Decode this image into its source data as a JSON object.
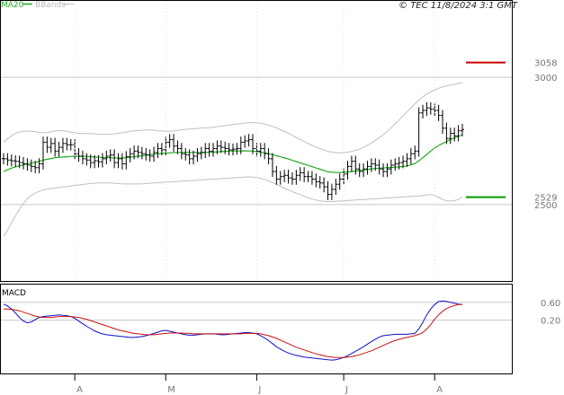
{
  "header": {
    "legend_ma": "MA20",
    "legend_bb": "BBands",
    "stamp": "© TEC 11/8/2024 3:1 GMT"
  },
  "colors": {
    "price": "#000000",
    "ma": "#22aa22",
    "bbands": "#c0c0c0",
    "resistance": "#cc0000",
    "support": "#009900",
    "macd_line": "#1010cc",
    "signal_line": "#cc1010",
    "grid": "#c8c8c8"
  },
  "chart_data": [
    {
      "type": "ohlc",
      "ylim": [
        2200,
        3300
      ],
      "yticks": [
        {
          "label": "3000",
          "value": 3000
        },
        {
          "label": "2500",
          "value": 2500
        }
      ],
      "xticks": [
        "A",
        "M",
        "J",
        "J",
        "A"
      ],
      "xtick_index": [
        18,
        41,
        64,
        86,
        109
      ],
      "levels": [
        {
          "label": "3058",
          "value": 3058,
          "kind": "resistance"
        },
        {
          "label": "2529",
          "value": 2529,
          "kind": "support"
        }
      ],
      "close": [
        2680,
        2675,
        2672,
        2670,
        2665,
        2660,
        2655,
        2650,
        2645,
        2660,
        2745,
        2725,
        2740,
        2710,
        2725,
        2740,
        2735,
        2735,
        2700,
        2690,
        2680,
        2675,
        2665,
        2672,
        2668,
        2680,
        2690,
        2695,
        2665,
        2680,
        2660,
        2688,
        2700,
        2710,
        2705,
        2700,
        2695,
        2690,
        2705,
        2720,
        2715,
        2745,
        2755,
        2730,
        2720,
        2700,
        2695,
        2680,
        2690,
        2700,
        2705,
        2720,
        2710,
        2720,
        2730,
        2725,
        2720,
        2715,
        2718,
        2720,
        2745,
        2750,
        2755,
        2720,
        2710,
        2720,
        2700,
        2680,
        2630,
        2600,
        2610,
        2615,
        2605,
        2600,
        2615,
        2625,
        2610,
        2610,
        2600,
        2590,
        2585,
        2570,
        2540,
        2560,
        2580,
        2600,
        2620,
        2650,
        2670,
        2640,
        2630,
        2640,
        2650,
        2660,
        2655,
        2640,
        2630,
        2640,
        2655,
        2660,
        2665,
        2670,
        2680,
        2700,
        2710,
        2860,
        2870,
        2880,
        2875,
        2870,
        2850,
        2800,
        2760,
        2780,
        2770,
        2790,
        2795
      ],
      "ma20": [
        2630,
        2637,
        2643,
        2648,
        2653,
        2656,
        2660,
        2663,
        2666,
        2670,
        2675,
        2678,
        2681,
        2684,
        2686,
        2687,
        2688,
        2689,
        2690,
        2690,
        2690,
        2689,
        2688,
        2687,
        2686,
        2685,
        2684,
        2684,
        2683,
        2683,
        2683,
        2684,
        2686,
        2688,
        2690,
        2692,
        2694,
        2696,
        2698,
        2700,
        2701,
        2702,
        2703,
        2704,
        2705,
        2705,
        2705,
        2705,
        2705,
        2705,
        2705,
        2705,
        2706,
        2706,
        2707,
        2708,
        2709,
        2710,
        2711,
        2711,
        2711,
        2711,
        2711,
        2710,
        2708,
        2706,
        2703,
        2700,
        2696,
        2692,
        2688,
        2683,
        2679,
        2674,
        2669,
        2664,
        2659,
        2654,
        2649,
        2644,
        2639,
        2634,
        2629,
        2627,
        2626,
        2626,
        2627,
        2628,
        2630,
        2632,
        2634,
        2636,
        2638,
        2640,
        2642,
        2643,
        2644,
        2645,
        2646,
        2647,
        2648,
        2650,
        2652,
        2656,
        2661,
        2672,
        2684,
        2697,
        2710,
        2722,
        2732,
        2740,
        2748,
        2756,
        2762,
        2768,
        2774
      ],
      "bb_upper": [
        2745,
        2758,
        2770,
        2780,
        2785,
        2788,
        2789,
        2788,
        2786,
        2784,
        2782,
        2783,
        2786,
        2789,
        2791,
        2790,
        2788,
        2785,
        2782,
        2780,
        2779,
        2779,
        2779,
        2778,
        2777,
        2776,
        2776,
        2777,
        2778,
        2780,
        2782,
        2785,
        2788,
        2790,
        2791,
        2792,
        2793,
        2793,
        2792,
        2790,
        2789,
        2788,
        2788,
        2790,
        2792,
        2794,
        2796,
        2797,
        2798,
        2799,
        2800,
        2801,
        2802,
        2804,
        2806,
        2808,
        2810,
        2812,
        2814,
        2816,
        2818,
        2820,
        2822,
        2822,
        2821,
        2819,
        2816,
        2812,
        2807,
        2801,
        2794,
        2787,
        2780,
        2772,
        2764,
        2756,
        2748,
        2740,
        2733,
        2726,
        2720,
        2714,
        2709,
        2706,
        2704,
        2703,
        2704,
        2706,
        2709,
        2713,
        2718,
        2725,
        2733,
        2742,
        2752,
        2763,
        2775,
        2788,
        2802,
        2817,
        2832,
        2848,
        2864,
        2880,
        2896,
        2910,
        2923,
        2934,
        2943,
        2951,
        2957,
        2962,
        2966,
        2970,
        2973,
        2976,
        2978
      ],
      "bb_lower": [
        2375,
        2400,
        2428,
        2456,
        2482,
        2505,
        2523,
        2536,
        2545,
        2552,
        2557,
        2561,
        2563,
        2565,
        2567,
        2569,
        2571,
        2573,
        2575,
        2577,
        2579,
        2581,
        2583,
        2584,
        2585,
        2585,
        2585,
        2585,
        2584,
        2583,
        2582,
        2581,
        2581,
        2581,
        2581,
        2582,
        2583,
        2584,
        2585,
        2586,
        2587,
        2588,
        2589,
        2590,
        2591,
        2592,
        2593,
        2594,
        2595,
        2596,
        2597,
        2598,
        2599,
        2600,
        2601,
        2602,
        2603,
        2604,
        2605,
        2606,
        2607,
        2608,
        2609,
        2608,
        2606,
        2603,
        2599,
        2593,
        2586,
        2579,
        2572,
        2565,
        2558,
        2551,
        2545,
        2539,
        2533,
        2527,
        2522,
        2518,
        2515,
        2513,
        2512,
        2512,
        2513,
        2514,
        2515,
        2516,
        2517,
        2518,
        2519,
        2520,
        2521,
        2522,
        2523,
        2524,
        2525,
        2526,
        2527,
        2528,
        2529,
        2530,
        2531,
        2532,
        2533,
        2534,
        2536,
        2538,
        2540,
        2536,
        2528,
        2520,
        2515,
        2514,
        2516,
        2520,
        2530
      ]
    },
    {
      "type": "line",
      "title": "MACD",
      "ylim": [
        -1,
        1
      ],
      "yticks": [
        {
          "label": "0.60",
          "value": 0.6
        },
        {
          "label": "0.20",
          "value": 0.2
        }
      ],
      "series": [
        {
          "key": "macd",
          "values": [
            0.56,
            0.52,
            0.45,
            0.36,
            0.26,
            0.18,
            0.14,
            0.16,
            0.21,
            0.26,
            0.28,
            0.29,
            0.3,
            0.31,
            0.32,
            0.31,
            0.3,
            0.28,
            0.24,
            0.18,
            0.12,
            0.06,
            0.01,
            -0.04,
            -0.08,
            -0.11,
            -0.13,
            -0.14,
            -0.15,
            -0.16,
            -0.17,
            -0.18,
            -0.19,
            -0.19,
            -0.18,
            -0.17,
            -0.15,
            -0.13,
            -0.1,
            -0.07,
            -0.04,
            -0.03,
            -0.05,
            -0.07,
            -0.09,
            -0.11,
            -0.13,
            -0.14,
            -0.14,
            -0.13,
            -0.12,
            -0.11,
            -0.11,
            -0.11,
            -0.12,
            -0.13,
            -0.13,
            -0.12,
            -0.11,
            -0.1,
            -0.09,
            -0.08,
            -0.08,
            -0.09,
            -0.11,
            -0.15,
            -0.2,
            -0.26,
            -0.33,
            -0.4,
            -0.45,
            -0.5,
            -0.54,
            -0.57,
            -0.59,
            -0.61,
            -0.63,
            -0.64,
            -0.65,
            -0.66,
            -0.67,
            -0.68,
            -0.69,
            -0.7,
            -0.69,
            -0.67,
            -0.64,
            -0.6,
            -0.55,
            -0.5,
            -0.45,
            -0.4,
            -0.34,
            -0.28,
            -0.23,
            -0.18,
            -0.15,
            -0.14,
            -0.13,
            -0.12,
            -0.12,
            -0.12,
            -0.12,
            -0.11,
            -0.1,
            0.0,
            0.15,
            0.32,
            0.45,
            0.55,
            0.62,
            0.63,
            0.62,
            0.6,
            0.58,
            0.56,
            0.55
          ]
        },
        {
          "key": "signal",
          "values": [
            0.45,
            0.45,
            0.44,
            0.43,
            0.41,
            0.38,
            0.35,
            0.32,
            0.29,
            0.27,
            0.26,
            0.26,
            0.26,
            0.27,
            0.28,
            0.28,
            0.28,
            0.28,
            0.27,
            0.26,
            0.24,
            0.22,
            0.19,
            0.16,
            0.13,
            0.1,
            0.07,
            0.04,
            0.01,
            -0.02,
            -0.04,
            -0.06,
            -0.08,
            -0.1,
            -0.11,
            -0.12,
            -0.13,
            -0.13,
            -0.13,
            -0.12,
            -0.11,
            -0.1,
            -0.09,
            -0.09,
            -0.09,
            -0.09,
            -0.1,
            -0.1,
            -0.11,
            -0.11,
            -0.11,
            -0.11,
            -0.11,
            -0.11,
            -0.11,
            -0.11,
            -0.11,
            -0.11,
            -0.11,
            -0.11,
            -0.11,
            -0.1,
            -0.1,
            -0.1,
            -0.1,
            -0.11,
            -0.13,
            -0.15,
            -0.18,
            -0.21,
            -0.25,
            -0.29,
            -0.33,
            -0.37,
            -0.41,
            -0.44,
            -0.47,
            -0.5,
            -0.53,
            -0.56,
            -0.58,
            -0.6,
            -0.62,
            -0.63,
            -0.64,
            -0.64,
            -0.64,
            -0.63,
            -0.62,
            -0.6,
            -0.58,
            -0.55,
            -0.52,
            -0.49,
            -0.45,
            -0.41,
            -0.37,
            -0.33,
            -0.29,
            -0.26,
            -0.23,
            -0.21,
            -0.19,
            -0.17,
            -0.15,
            -0.12,
            -0.08,
            0.0,
            0.1,
            0.22,
            0.32,
            0.4,
            0.46,
            0.5,
            0.53,
            0.55,
            0.55
          ]
        }
      ]
    }
  ]
}
